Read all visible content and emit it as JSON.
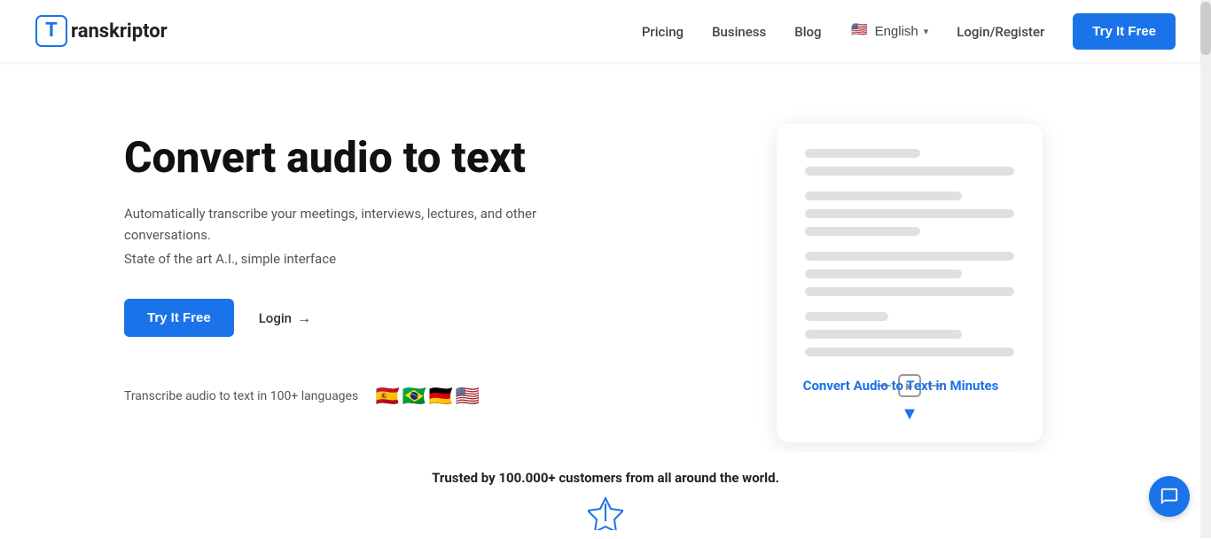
{
  "navbar": {
    "logo_text": "ranskriptor",
    "logo_letter": "T",
    "nav_items": [
      {
        "label": "Pricing",
        "href": "#"
      },
      {
        "label": "Business",
        "href": "#"
      },
      {
        "label": "Blog",
        "href": "#"
      }
    ],
    "language": "English",
    "login_label": "Login/Register",
    "try_btn_label": "Try It Free"
  },
  "hero": {
    "title": "Convert audio to text",
    "subtitle": "Automatically transcribe your meetings, interviews, lectures, and other conversations.",
    "tagline": "State of the art A.I., simple interface",
    "try_btn_label": "Try It Free",
    "login_label": "Login",
    "login_arrow": "→",
    "languages_text": "Transcribe audio to text in 100+ languages",
    "flags": [
      "🇪🇸",
      "🇧🇷",
      "🇩🇪",
      "🇺🇸"
    ],
    "illustration_caption": "Convert Audio to Text in Minutes"
  },
  "trusted": {
    "text": "Trusted by 100.000+ customers from all around the world."
  },
  "icons": {
    "chevron_down": "▾",
    "arrow_right": "→",
    "chat_icon": "chat"
  }
}
